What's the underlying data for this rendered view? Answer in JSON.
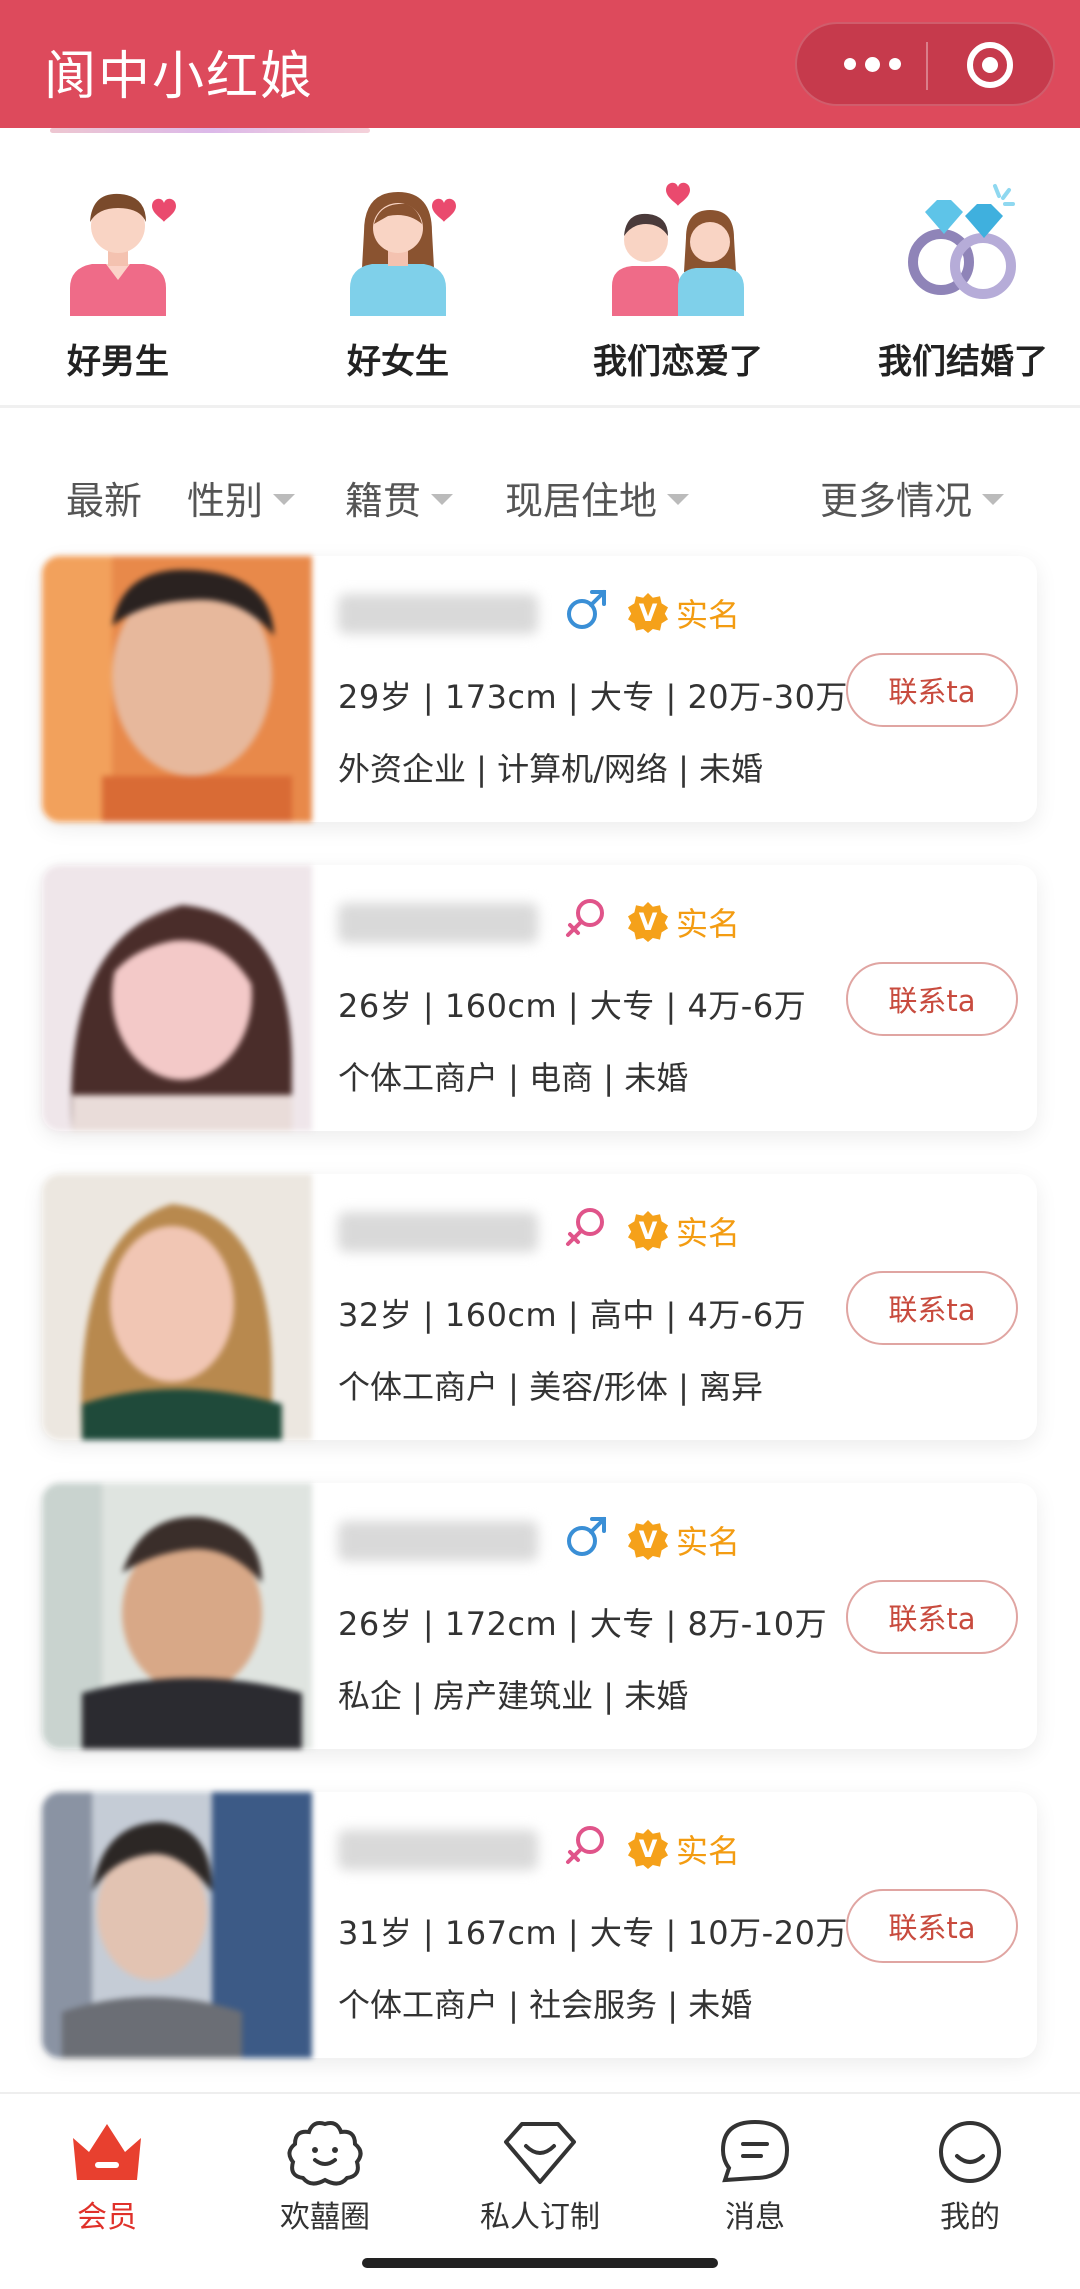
{
  "app": {
    "title": "阆中小红娘"
  },
  "categories": [
    {
      "label": "好男生",
      "icon": "boy-heart-icon"
    },
    {
      "label": "好女生",
      "icon": "girl-heart-icon"
    },
    {
      "label": "我们恋爱了",
      "icon": "couple-heart-icon"
    },
    {
      "label": "我们结婚了",
      "icon": "rings-icon"
    }
  ],
  "filters": [
    {
      "label": "最新",
      "dropdown": false
    },
    {
      "label": "性别",
      "dropdown": true
    },
    {
      "label": "籍贯",
      "dropdown": true
    },
    {
      "label": "现居住地",
      "dropdown": true
    },
    {
      "label": "更多情况",
      "dropdown": true
    }
  ],
  "members": [
    {
      "gender": "male",
      "verified": "实名",
      "line1": "29岁 | 173cm | 大专 | 20万-30万",
      "line2": "外资企业 | 计算机/网络 | 未婚",
      "contact": "联系ta"
    },
    {
      "gender": "female",
      "verified": "实名",
      "line1": "26岁 | 160cm | 大专 | 4万-6万",
      "line2": "个体工商户 | 电商 | 未婚",
      "contact": "联系ta"
    },
    {
      "gender": "female",
      "verified": "实名",
      "line1": "32岁 | 160cm | 高中 | 4万-6万",
      "line2": "个体工商户 | 美容/形体 | 离异",
      "contact": "联系ta"
    },
    {
      "gender": "male",
      "verified": "实名",
      "line1": "26岁 | 172cm | 大专 | 8万-10万",
      "line2": "私企 | 房产建筑业 | 未婚",
      "contact": "联系ta"
    },
    {
      "gender": "female",
      "verified": "实名",
      "line1": "31岁 | 167cm | 大专 | 10万-20万",
      "line2": "个体工商户 | 社会服务 | 未婚",
      "contact": "联系ta"
    }
  ],
  "tabs": [
    {
      "label": "会员",
      "icon": "crown-icon",
      "active": true
    },
    {
      "label": "欢囍圈",
      "icon": "flower-face-icon",
      "active": false
    },
    {
      "label": "私人订制",
      "icon": "heart-smile-icon",
      "active": false
    },
    {
      "label": "消息",
      "icon": "chat-bubble-icon",
      "active": false
    },
    {
      "label": "我的",
      "icon": "smiley-icon",
      "active": false
    }
  ],
  "colors": {
    "header": "#dd4a5c",
    "accent": "#e0312a",
    "verified": "#f39c12",
    "male": "#3a8fd6",
    "female": "#e0548a"
  }
}
